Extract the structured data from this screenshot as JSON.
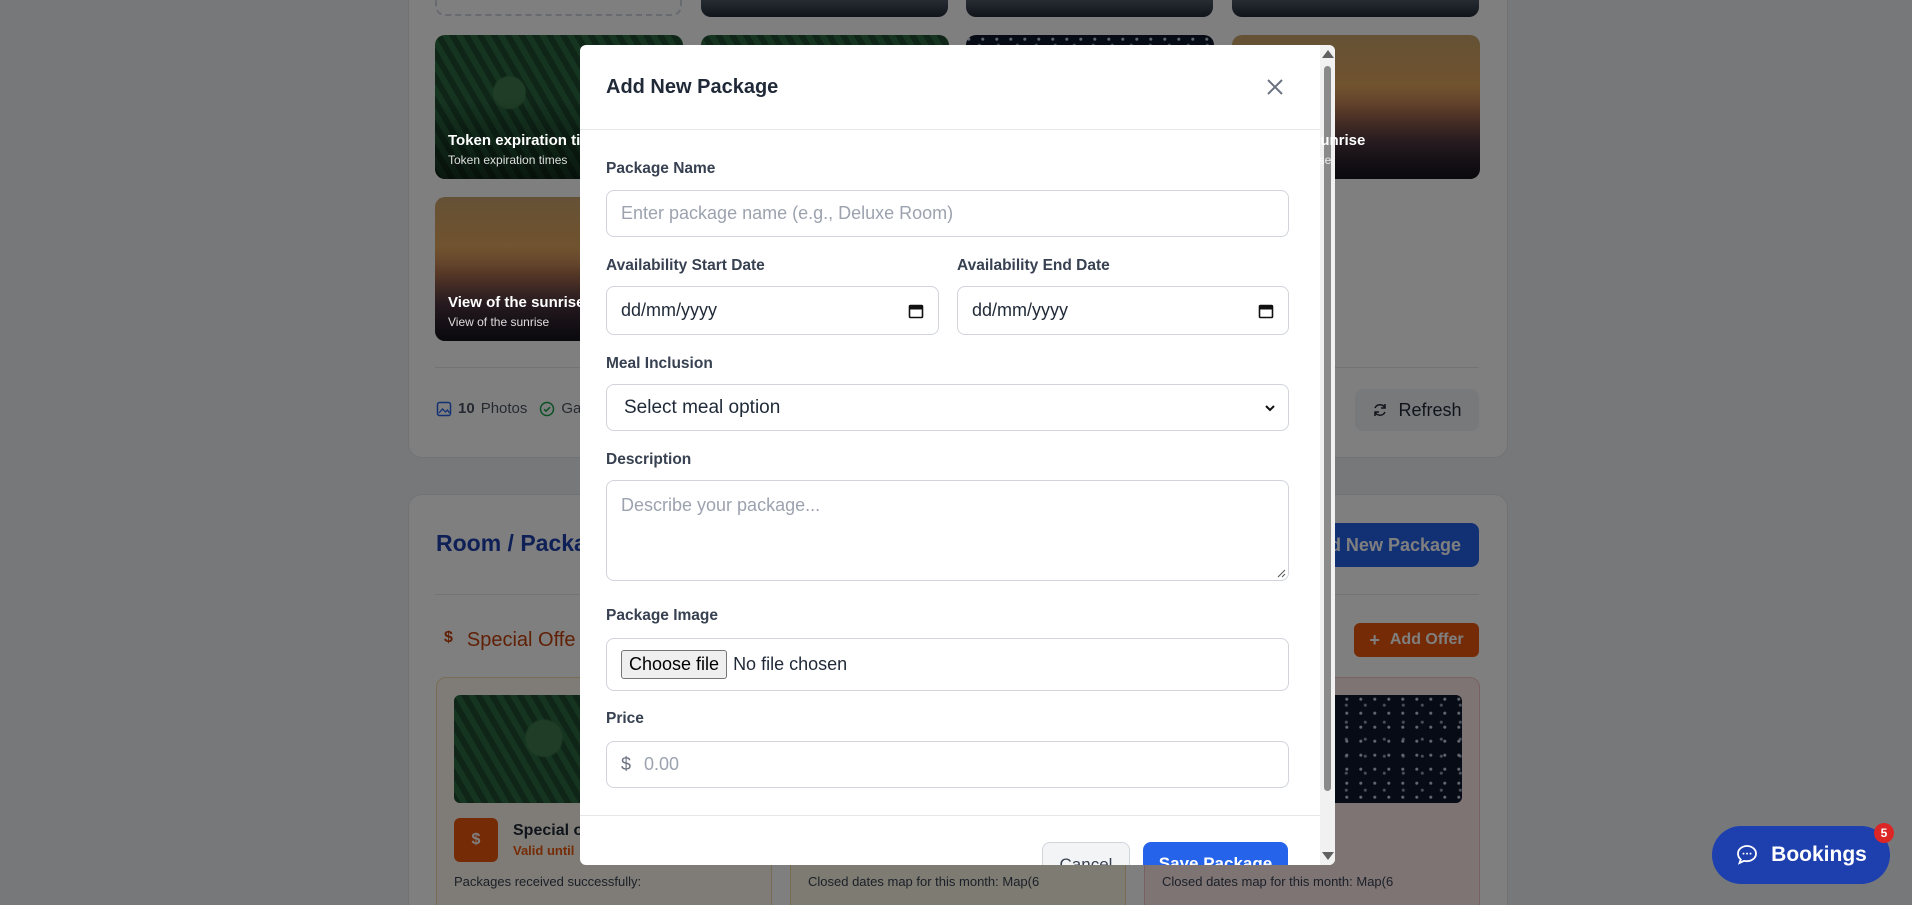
{
  "background": {
    "gallery_photos": [
      {
        "title": "Token expiration ti",
        "subtitle": "Token expiration times"
      },
      {
        "title": "",
        "subtitle": ""
      },
      {
        "title": "",
        "subtitle": ""
      },
      {
        "title": "sunrise",
        "subtitle": "rise"
      },
      {
        "title": "View of the sunrise",
        "subtitle": "View of the sunrise"
      }
    ],
    "stats": {
      "photos_count": "10",
      "photos_label": "Photos",
      "gallery_label": "Ga"
    },
    "refresh_label": "Refresh",
    "section_title": "Room / Packa",
    "add_package_label": "d New Package",
    "offers_title": "Special Offe",
    "offers_icon": "$",
    "add_offer_label": "Add Offer",
    "offers": [
      {
        "title": "Special o",
        "valid": "Valid until",
        "icon": "$",
        "text": "Packages received successfully:"
      },
      {
        "title": "",
        "valid": "",
        "icon": "",
        "text": "Closed dates map for this month: Map(6"
      },
      {
        "title": "",
        "valid": "",
        "icon": "",
        "text": "Closed dates map for this month: Map(6"
      }
    ],
    "bookings_label": "Bookings",
    "bookings_badge": "5"
  },
  "modal": {
    "title": "Add New Package",
    "package_name": {
      "label": "Package Name",
      "placeholder": "Enter package name (e.g., Deluxe Room)",
      "value": ""
    },
    "start_date": {
      "label": "Availability Start Date",
      "value": "dd/mm/yyyy"
    },
    "end_date": {
      "label": "Availability End Date",
      "value": "dd/mm/yyyy"
    },
    "meal": {
      "label": "Meal Inclusion",
      "selected": "Select meal option"
    },
    "description": {
      "label": "Description",
      "placeholder": "Describe your package..."
    },
    "image": {
      "label": "Package Image",
      "button": "Choose file",
      "status": "No file chosen"
    },
    "price": {
      "label": "Price",
      "currency": "$",
      "placeholder": "0.00"
    },
    "cancel_label": "Cancel",
    "save_label": "Save Package"
  },
  "colors": {
    "primary": "#2563eb",
    "accent_orange": "#ea580c",
    "title_blue": "#1e40af"
  }
}
